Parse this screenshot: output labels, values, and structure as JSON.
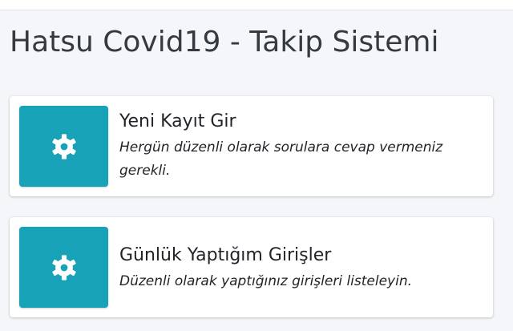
{
  "page": {
    "title": "Hatsu Covid19 - Takip Sistemi"
  },
  "cards": [
    {
      "icon": "gear-icon",
      "title": "Yeni Kayıt Gir",
      "description": "Hergün düzenli olarak sorulara cevap vermeniz gerekli."
    },
    {
      "icon": "gear-icon",
      "title": "Günlük Yaptığım Girişler",
      "description": "Düzenli olarak yaptığınız girişleri listeleyin."
    }
  ],
  "colors": {
    "accent": "#17a2b8",
    "background": "#f4f6f9",
    "card": "#ffffff",
    "text": "#212529"
  }
}
